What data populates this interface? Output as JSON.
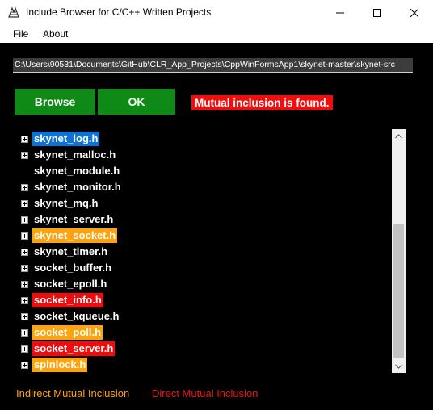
{
  "window": {
    "title": "Include Browser for C/C++ Written Projects",
    "controls": {
      "minimize": "—",
      "maximize": "☐",
      "close": "✕"
    }
  },
  "menu": {
    "file": "File",
    "about": "About"
  },
  "path": {
    "value": "C:\\Users\\90531\\Documents\\GitHub\\CLR_App_Projects\\CppWinFormsApp1\\skynet-master\\skynet-src"
  },
  "buttons": {
    "browse": "Browse",
    "ok": "OK"
  },
  "status": {
    "text": "Mutual inclusion is found.",
    "color": "#ee0e0e"
  },
  "tree": {
    "items": [
      {
        "label": "skynet_log.h",
        "expandable": true,
        "highlight": "blue"
      },
      {
        "label": "skynet_malloc.h",
        "expandable": true,
        "highlight": "none"
      },
      {
        "label": "skynet_module.h",
        "expandable": false,
        "highlight": "none"
      },
      {
        "label": "skynet_monitor.h",
        "expandable": true,
        "highlight": "none"
      },
      {
        "label": "skynet_mq.h",
        "expandable": true,
        "highlight": "none"
      },
      {
        "label": "skynet_server.h",
        "expandable": true,
        "highlight": "none"
      },
      {
        "label": "skynet_socket.h",
        "expandable": true,
        "highlight": "orange"
      },
      {
        "label": "skynet_timer.h",
        "expandable": true,
        "highlight": "none"
      },
      {
        "label": "socket_buffer.h",
        "expandable": true,
        "highlight": "none"
      },
      {
        "label": "socket_epoll.h",
        "expandable": true,
        "highlight": "none"
      },
      {
        "label": "socket_info.h",
        "expandable": true,
        "highlight": "red"
      },
      {
        "label": "socket_kqueue.h",
        "expandable": true,
        "highlight": "none"
      },
      {
        "label": "socket_poll.h",
        "expandable": true,
        "highlight": "orange"
      },
      {
        "label": "socket_server.h",
        "expandable": true,
        "highlight": "red"
      },
      {
        "label": "spinlock.h",
        "expandable": true,
        "highlight": "orange"
      }
    ]
  },
  "legend": {
    "indirect": "Indirect Mutual Inclusion",
    "direct": "Direct Mutual Inclusion",
    "indirect_color": "#ffa30a",
    "direct_color": "#ee1515"
  },
  "colors": {
    "button_green": "#0f8a16",
    "highlight_blue": "#0c72d6",
    "highlight_orange": "#ffa30a",
    "highlight_red": "#f00c0c"
  }
}
